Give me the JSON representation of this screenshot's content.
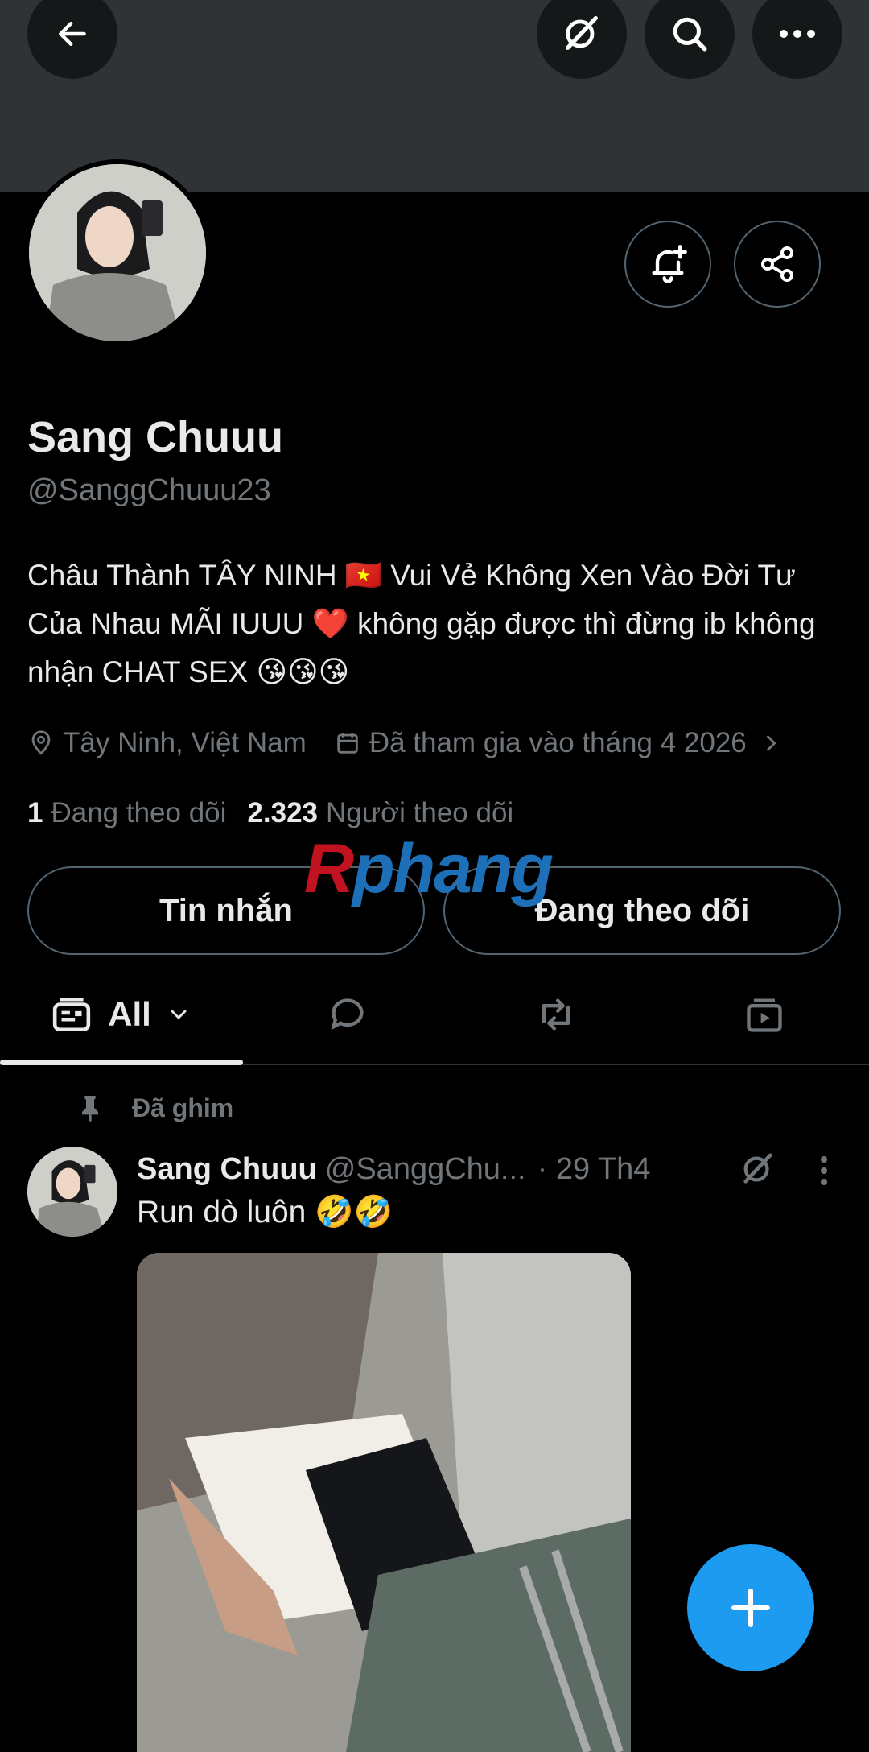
{
  "profile": {
    "name": "Sang Chuuu",
    "handle": "@SanggChuuu23",
    "bio": "Châu Thành TÂY NINH 🇻🇳 Vui Vẻ Không Xen Vào Đời Tư Của Nhau MÃI IUUU ❤️ không gặp được thì đừng ib không nhận CHAT SEX 😘😘😘",
    "location": "Tây Ninh, Việt Nam",
    "joined": "Đã tham gia vào tháng 4 2026",
    "following_count": "1",
    "following_label": "Đang theo dõi",
    "followers_count": "2.323",
    "followers_label": "Người theo dõi"
  },
  "actions": {
    "message_label": "Tin nhắn",
    "following_button_label": "Đang theo dõi"
  },
  "watermark": {
    "r": "R",
    "rest": "phang"
  },
  "tabs": {
    "all_label": "All"
  },
  "post": {
    "pinned_label": "Đã ghim",
    "author_name": "Sang Chuuu",
    "author_handle": "@SanggChu...",
    "time": "· 29 Th4",
    "text": "Run dò luôn 🤣🤣"
  },
  "icons": {
    "back": "back-arrow-icon",
    "grok": "grok-icon",
    "search": "search-icon",
    "more": "more-horizontal-icon",
    "notify": "bell-plus-icon",
    "share": "share-icon",
    "compose": "plus-icon"
  },
  "colors": {
    "accent": "#1d9bf0",
    "muted": "#71767b",
    "border": "#536471",
    "banner": "#2f3336"
  }
}
